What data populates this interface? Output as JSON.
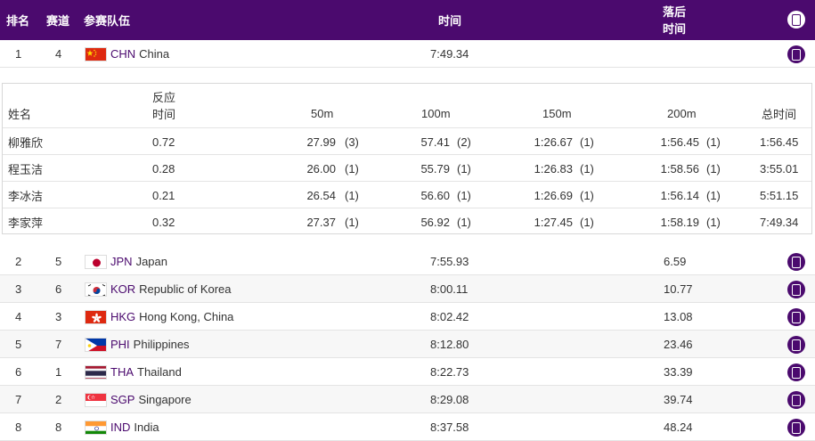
{
  "header": {
    "rank": "排名",
    "lane": "赛道",
    "team": "参赛队伍",
    "time": "时间",
    "behind_line1": "落后",
    "behind_line2": "时间"
  },
  "first_row": {
    "rank": "1",
    "lane": "4",
    "code": "CHN",
    "name": "China",
    "time": "7:49.34",
    "behind": ""
  },
  "detail": {
    "headers": {
      "name": "姓名",
      "reaction_line1": "反应",
      "reaction_line2": "时间",
      "m50": "50m",
      "m100": "100m",
      "m150": "150m",
      "m200": "200m",
      "total": "总时间"
    },
    "swimmers": [
      {
        "name": "柳雅欣",
        "reaction": "0.72",
        "m50": "27.99",
        "m50_rank": "(3)",
        "m100": "57.41",
        "m100_rank": "(2)",
        "m150": "1:26.67",
        "m150_rank": "(1)",
        "m200": "1:56.45",
        "m200_rank": "(1)",
        "total": "1:56.45"
      },
      {
        "name": "程玉洁",
        "reaction": "0.28",
        "m50": "26.00",
        "m50_rank": "(1)",
        "m100": "55.79",
        "m100_rank": "(1)",
        "m150": "1:26.83",
        "m150_rank": "(1)",
        "m200": "1:58.56",
        "m200_rank": "(1)",
        "total": "3:55.01"
      },
      {
        "name": "李冰洁",
        "reaction": "0.21",
        "m50": "26.54",
        "m50_rank": "(1)",
        "m100": "56.60",
        "m100_rank": "(1)",
        "m150": "1:26.69",
        "m150_rank": "(1)",
        "m200": "1:56.14",
        "m200_rank": "(1)",
        "total": "5:51.15"
      },
      {
        "name": "李家萍",
        "reaction": "0.32",
        "m50": "27.37",
        "m50_rank": "(1)",
        "m100": "56.92",
        "m100_rank": "(1)",
        "m150": "1:27.45",
        "m150_rank": "(1)",
        "m200": "1:58.19",
        "m200_rank": "(1)",
        "total": "7:49.34"
      }
    ]
  },
  "rows": [
    {
      "rank": "2",
      "lane": "5",
      "code": "JPN",
      "name": "Japan",
      "time": "7:55.93",
      "behind": "6.59",
      "flag": "jpn"
    },
    {
      "rank": "3",
      "lane": "6",
      "code": "KOR",
      "name": "Republic of Korea",
      "time": "8:00.11",
      "behind": "10.77",
      "flag": "kor"
    },
    {
      "rank": "4",
      "lane": "3",
      "code": "HKG",
      "name": "Hong Kong, China",
      "time": "8:02.42",
      "behind": "13.08",
      "flag": "hkg"
    },
    {
      "rank": "5",
      "lane": "7",
      "code": "PHI",
      "name": "Philippines",
      "time": "8:12.80",
      "behind": "23.46",
      "flag": "phi"
    },
    {
      "rank": "6",
      "lane": "1",
      "code": "THA",
      "name": "Thailand",
      "time": "8:22.73",
      "behind": "33.39",
      "flag": "tha"
    },
    {
      "rank": "7",
      "lane": "2",
      "code": "SGP",
      "name": "Singapore",
      "time": "8:29.08",
      "behind": "39.74",
      "flag": "sgp"
    },
    {
      "rank": "8",
      "lane": "8",
      "code": "IND",
      "name": "India",
      "time": "8:37.58",
      "behind": "48.24",
      "flag": "ind"
    }
  ],
  "colors": {
    "header_bg": "#4b0a6e",
    "accent": "#4b0a6e",
    "row_alt": "#f7f7f7"
  },
  "icons": {
    "expand": "expand-toggle-icon"
  }
}
